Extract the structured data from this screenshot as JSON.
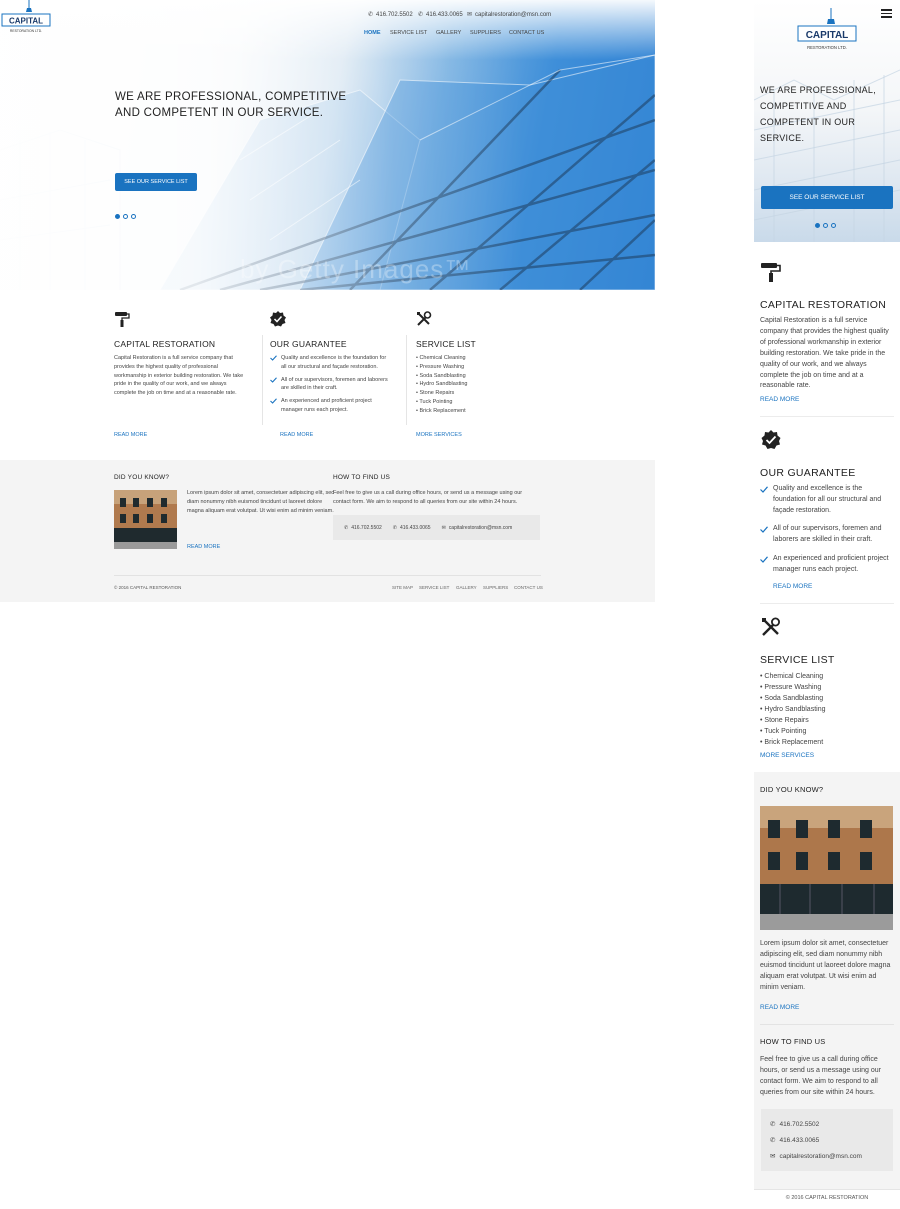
{
  "brand": {
    "logo_main": "CAPITAL",
    "logo_sub": "RESTORATION LTD.",
    "accent_color": "#1a73c0"
  },
  "contact": {
    "phone1": "416.702.5502",
    "phone2": "416.433.0065",
    "email": "capitalrestoration@msn.com"
  },
  "nav": {
    "items": [
      "HOME",
      "SERVICE LIST",
      "GALLERY",
      "SUPPLIERS",
      "CONTACT US"
    ],
    "active": "HOME"
  },
  "hero": {
    "title": "WE ARE PROFESSIONAL, COMPETITIVE AND COMPETENT IN OUR SERVICE.",
    "cta": "SEE OUR SERVICE LIST",
    "watermark": "by Getty Images™",
    "slide_count": 3,
    "active_slide": 1
  },
  "features": {
    "restoration": {
      "icon": "paint-roller-icon",
      "title": "CAPITAL RESTORATION",
      "body": "Capital Restoration is a full service company that provides the highest quality of professional workmanship in exterior building restoration. We take pride in the quality of our work, and we always complete the job on time and at a reasonable rate.",
      "link": "READ MORE"
    },
    "guarantee": {
      "icon": "verified-badge-icon",
      "title": "OUR GUARANTEE",
      "points": [
        "Quality and excellence is the foundation for all our structural and façade restoration.",
        "All of our supervisors, foremen and laborers are skilled in their craft.",
        "An experienced and proficient project manager runs each project."
      ],
      "link": "READ MORE"
    },
    "services": {
      "icon": "tools-icon",
      "title": "SERVICE LIST",
      "items": [
        "• Chemical Cleaning",
        "• Pressure Washing",
        "• Soda Sandblasting",
        "• Hydro Sandblasting",
        "• Stone Repairs",
        "• Tuck Pointing",
        "• Brick Replacement"
      ],
      "link": "MORE SERVICES"
    }
  },
  "did_you_know": {
    "title": "DID YOU KNOW?",
    "body": "Lorem ipsum dolor sit amet, consectetuer adipiscing elit, sed diam nonummy nibh euismod tincidunt ut laoreet dolore magna aliquam erat volutpat. Ut wisi enim ad minim veniam.",
    "link": "READ MORE"
  },
  "find_us": {
    "title": "HOW TO FIND US",
    "body": "Feel free to give us a call during office hours, or send us a message using our contact form. We aim to respond to all queries from our site within 24 hours."
  },
  "footer": {
    "copyright": "© 2016 CAPITAL RESTORATION",
    "links": [
      "SITE MAP",
      "SERVICE LIST",
      "GALLERY",
      "SUPPLIERS",
      "CONTACT US"
    ]
  }
}
